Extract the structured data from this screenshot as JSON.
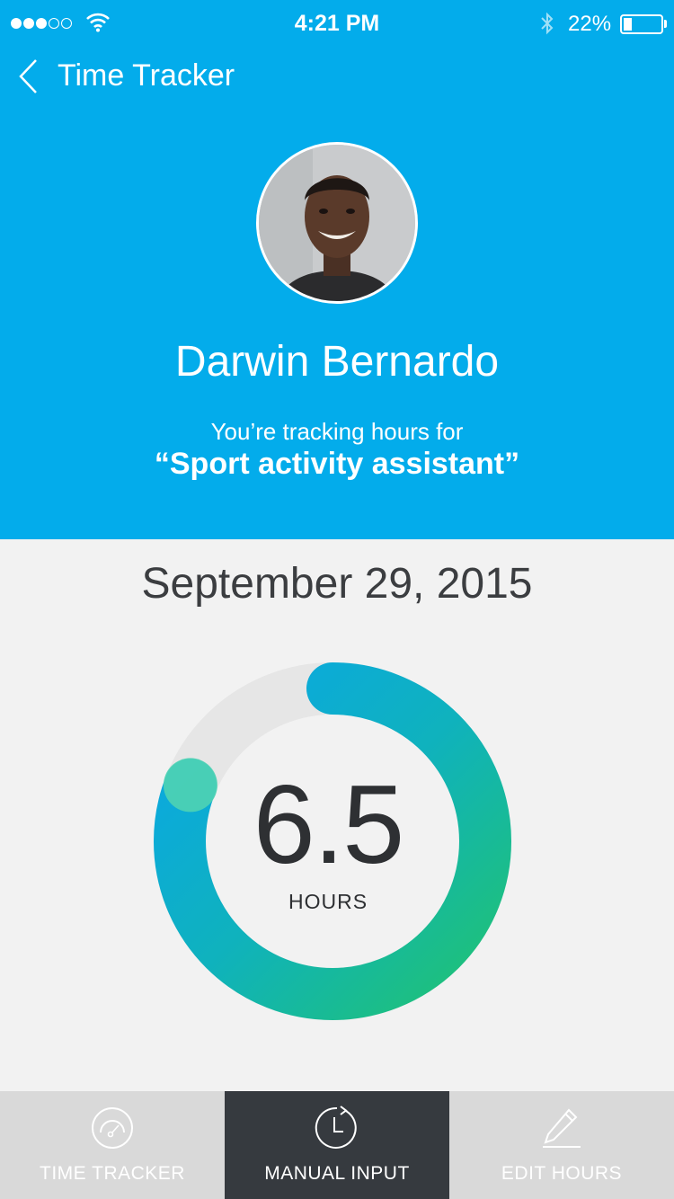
{
  "status_bar": {
    "time": "4:21 PM",
    "battery_percent": "22%",
    "battery_level": 0.22,
    "signal_dots_filled": 3,
    "signal_dots_total": 5
  },
  "nav": {
    "back_icon": "chevron-left-icon",
    "title": "Time Tracker"
  },
  "profile": {
    "name": "Darwin Bernardo",
    "tracking_label": "You’re tracking hours for",
    "project": "“Sport activity assistant”"
  },
  "tracker": {
    "date": "September 29, 2015",
    "hours_value": "6.5",
    "hours_unit": "HOURS",
    "progress_fraction": 0.81
  },
  "tabs": [
    {
      "label": "TIME TRACKER",
      "icon": "speedometer-icon",
      "active": false
    },
    {
      "label": "MANUAL INPUT",
      "icon": "clock-icon",
      "active": true
    },
    {
      "label": "EDIT HOURS",
      "icon": "pencil-icon",
      "active": false
    }
  ],
  "colors": {
    "header_blue": "#03aceb",
    "ring_green": "#20c274",
    "ring_teal": "#0fb2bd",
    "ring_blue": "#0aa7e6",
    "ring_track": "#e6e6e6",
    "tab_active": "#363a3f",
    "tab_inactive": "#d9d9d9"
  }
}
